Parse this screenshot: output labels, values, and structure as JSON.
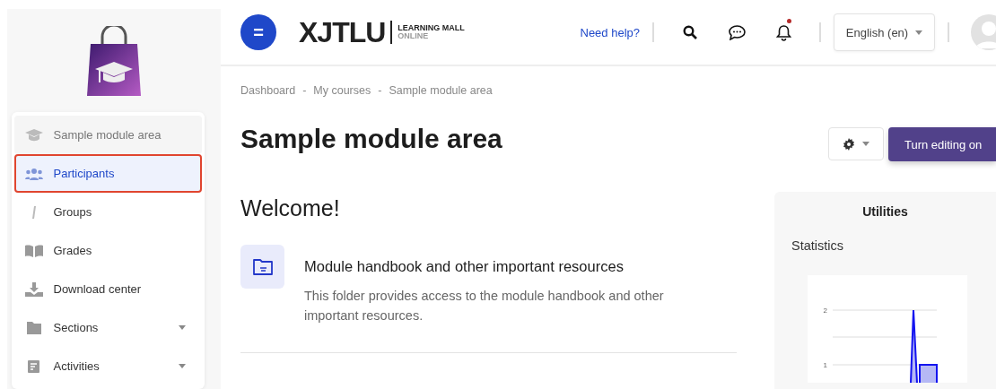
{
  "brand": {
    "name": "XJTLU",
    "tagline_top": "LEARNING MALL",
    "tagline_bottom": "ONLINE"
  },
  "header": {
    "menu_button": "=",
    "help_link": "Need help?",
    "notification_dot": true,
    "language": "English (en)"
  },
  "sidebar": {
    "items": [
      {
        "label": "Sample module area",
        "kind": "course",
        "selected": false,
        "expandable": false
      },
      {
        "label": "Participants",
        "kind": "participants",
        "selected": true,
        "expandable": false
      },
      {
        "label": "Groups",
        "kind": "groups",
        "selected": false,
        "expandable": false
      },
      {
        "label": "Grades",
        "kind": "grades",
        "selected": false,
        "expandable": false
      },
      {
        "label": "Download center",
        "kind": "download",
        "selected": false,
        "expandable": false
      },
      {
        "label": "Sections",
        "kind": "sections",
        "selected": false,
        "expandable": true
      },
      {
        "label": "Activities",
        "kind": "activities",
        "selected": false,
        "expandable": true
      }
    ]
  },
  "breadcrumb": [
    "Dashboard",
    "My courses",
    "Sample module area"
  ],
  "breadcrumb_separator": "-",
  "page_title": "Sample module area",
  "edit_button": "Turn editing on",
  "section_title": "Welcome!",
  "activity": {
    "title": "Module handbook and other important resources",
    "description": "This folder provides access to the module handbook and other important resources."
  },
  "utilities": {
    "title": "Utilities",
    "statistics_title": "Statistics",
    "y_labels": [
      "2",
      "1"
    ]
  }
}
